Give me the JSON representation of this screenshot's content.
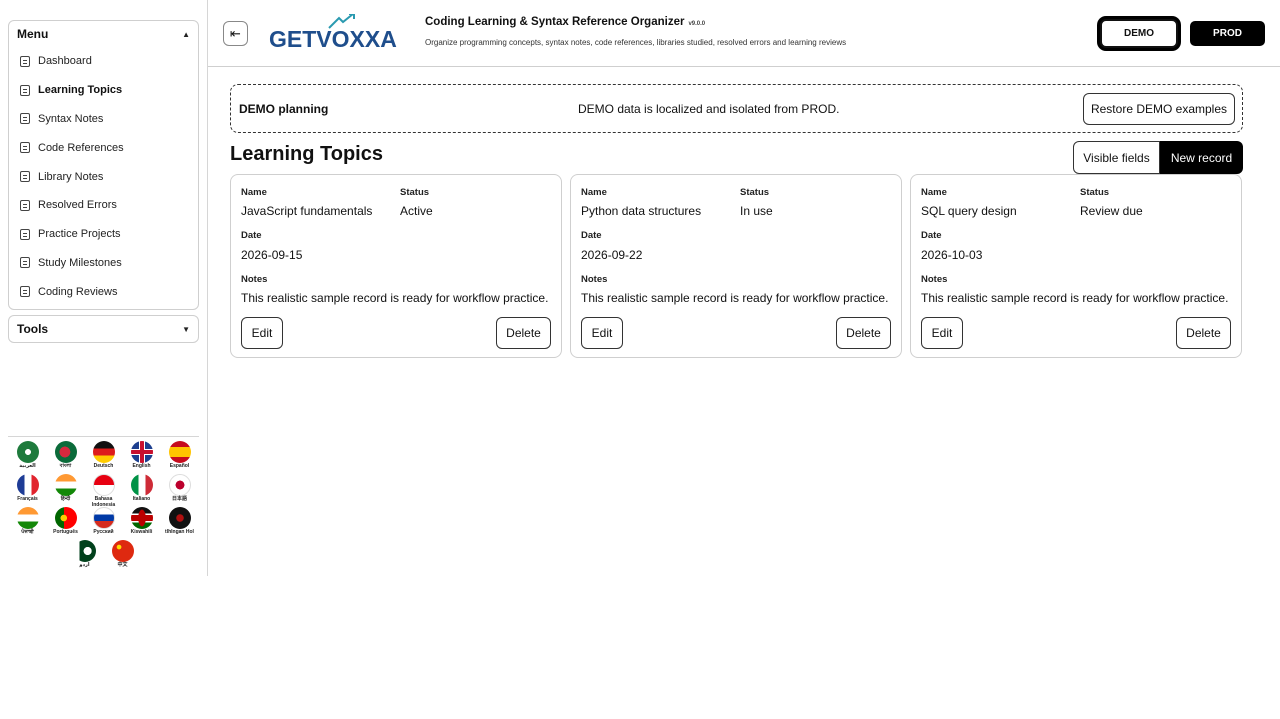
{
  "sidebar": {
    "menu_title": "Menu",
    "items": [
      {
        "label": "Dashboard"
      },
      {
        "label": "Learning Topics"
      },
      {
        "label": "Syntax Notes"
      },
      {
        "label": "Code References"
      },
      {
        "label": "Library Notes"
      },
      {
        "label": "Resolved Errors"
      },
      {
        "label": "Practice Projects"
      },
      {
        "label": "Study Milestones"
      },
      {
        "label": "Coding Reviews"
      }
    ],
    "active_item": "Learning Topics",
    "tools_title": "Tools",
    "languages": [
      {
        "label": "العربية",
        "icon": "saudi-arabia-flag-icon"
      },
      {
        "label": "বাংলা",
        "icon": "bangladesh-flag-icon"
      },
      {
        "label": "Deutsch",
        "icon": "germany-flag-icon"
      },
      {
        "label": "English",
        "icon": "uk-flag-icon"
      },
      {
        "label": "Español",
        "icon": "spain-flag-icon"
      },
      {
        "label": "Français",
        "icon": "france-flag-icon"
      },
      {
        "label": "हिन्दी",
        "icon": "india-flag-icon"
      },
      {
        "label": "Bahasa Indonesia",
        "icon": "indonesia-flag-icon"
      },
      {
        "label": "Italiano",
        "icon": "italy-flag-icon"
      },
      {
        "label": "日本語",
        "icon": "japan-flag-icon"
      },
      {
        "label": "ਪੰਜਾਬੀ",
        "icon": "india-flag-icon"
      },
      {
        "label": "Português",
        "icon": "portugal-flag-icon"
      },
      {
        "label": "Русский",
        "icon": "russia-flag-icon"
      },
      {
        "label": "Kiswahili",
        "icon": "kenya-flag-icon"
      },
      {
        "label": "tlhIngan Hol",
        "icon": "klingon-flag-icon"
      },
      {
        "label": "اردو",
        "icon": "pakistan-flag-icon"
      },
      {
        "label": "中文",
        "icon": "china-flag-icon"
      }
    ]
  },
  "header": {
    "logo_text": "GETVOXXA",
    "title": "Coding Learning & Syntax Reference Organizer",
    "version": "v9.0.0",
    "subtitle": "Organize programming concepts, syntax notes, code references, libraries studied, resolved errors and learning reviews",
    "env_demo": "DEMO",
    "env_prod": "PROD",
    "active_env": "DEMO"
  },
  "banner": {
    "title": "DEMO planning",
    "message": "DEMO data is localized and isolated from PROD.",
    "restore_label": "Restore DEMO examples"
  },
  "main": {
    "title": "Learning Topics",
    "visible_fields_label": "Visible fields",
    "new_record_label": "New record",
    "field_labels": {
      "name": "Name",
      "status": "Status",
      "date": "Date",
      "notes": "Notes"
    },
    "edit_label": "Edit",
    "delete_label": "Delete",
    "records": [
      {
        "name": "JavaScript fundamentals",
        "status": "Active",
        "date": "2026-09-15",
        "notes": "This realistic sample record is ready for workflow practice."
      },
      {
        "name": "Python data structures",
        "status": "In use",
        "date": "2026-09-22",
        "notes": "This realistic sample record is ready for workflow practice."
      },
      {
        "name": "SQL query design",
        "status": "Review due",
        "date": "2026-10-03",
        "notes": "This realistic sample record is ready for workflow practice."
      }
    ]
  },
  "colors": {
    "accent": "#000000",
    "logo_blue": "#1f4e8c",
    "logo_teal": "#2a9ab0",
    "border": "#cfcfcf"
  }
}
